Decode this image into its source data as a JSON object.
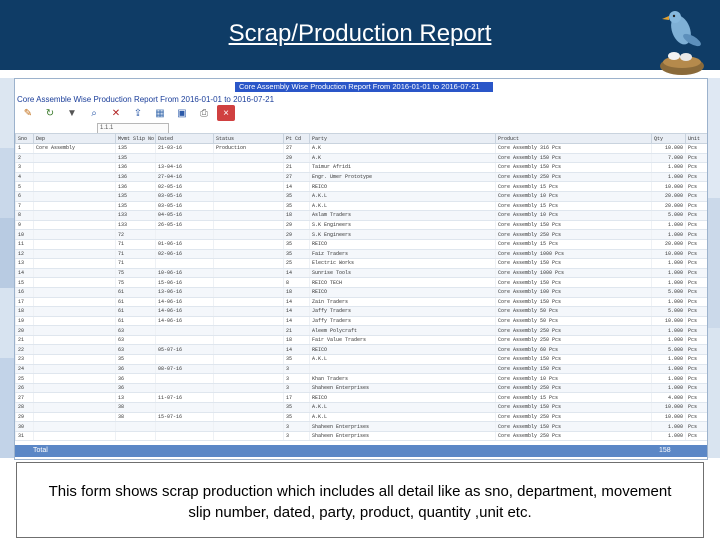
{
  "slide": {
    "title": "Scrap/Production Report",
    "caption": "This form shows scrap production which includes all detail like as sno, department, movement slip number, dated, party, product, quantity ,unit etc."
  },
  "app": {
    "report_banner": "Core Assembly Wise Production Report From 2016-01-01 to 2016-07-21",
    "window_caption": "Core Assemble Wise Production Report From 2016-01-01 to 2016-07-21",
    "toolbar_icons": [
      "pencil-icon",
      "refresh-icon",
      "filter-icon",
      "find-icon",
      "delete-icon",
      "export-icon",
      "grid-icon",
      "save-icon",
      "print-icon",
      "close-icon"
    ],
    "filter_placeholder": "1.1.1",
    "columns": [
      "Sno",
      "Dep",
      "Mvmt Slip No",
      "Dated",
      "Status",
      "Pt Cd",
      "Party",
      "Product",
      "Qty",
      "Unit"
    ],
    "rows": [
      [
        "1",
        "Core Assembly",
        "135",
        "21-03-16",
        "Production",
        "27",
        "A.K",
        "Core Assembly 316 Pcs",
        "10.000",
        "Pcs"
      ],
      [
        "2",
        "",
        "135",
        "",
        "",
        "29",
        "A.K",
        "Core Assembly 150 Pcs",
        "7.000",
        "Pcs"
      ],
      [
        "3",
        "",
        "136",
        "13-04-16",
        "",
        "21",
        "Taimur Afridi",
        "Core Assembly 150 Pcs",
        "1.000",
        "Pcs"
      ],
      [
        "4",
        "",
        "136",
        "27-04-16",
        "",
        "27",
        "Engr. Umer Prototype",
        "Core Assembly 250 Pcs",
        "1.000",
        "Pcs"
      ],
      [
        "5",
        "",
        "136",
        "02-05-16",
        "",
        "14",
        "REICO",
        "Core Assembly 15 Pcs",
        "10.000",
        "Pcs"
      ],
      [
        "6",
        "",
        "135",
        "03-05-16",
        "",
        "35",
        "A.K.L",
        "Core Assembly 10 Pcs",
        "20.000",
        "Pcs"
      ],
      [
        "7",
        "",
        "135",
        "03-05-16",
        "",
        "35",
        "A.K.L",
        "Core Assembly 15 Pcs",
        "20.000",
        "Pcs"
      ],
      [
        "8",
        "",
        "133",
        "04-05-16",
        "",
        "18",
        "Aslam Traders",
        "Core Assembly 10 Pcs",
        "5.000",
        "Pcs"
      ],
      [
        "9",
        "",
        "133",
        "26-05-16",
        "",
        "29",
        "S.K Engineers",
        "Core Assembly 150 Pcs",
        "1.000",
        "Pcs"
      ],
      [
        "10",
        "",
        "72",
        "",
        "",
        "29",
        "S.K Engineers",
        "Core Assembly 250 Pcs",
        "1.000",
        "Pcs"
      ],
      [
        "11",
        "",
        "71",
        "01-06-16",
        "",
        "35",
        "REICO",
        "Core Assembly 15 Pcs",
        "20.000",
        "Pcs"
      ],
      [
        "12",
        "",
        "71",
        "02-06-16",
        "",
        "35",
        "Faiz Traders",
        "Core Assembly 1000 Pcs",
        "10.000",
        "Pcs"
      ],
      [
        "13",
        "",
        "71",
        "",
        "",
        "25",
        "Electric Works",
        "Core Assembly 150 Pcs",
        "1.000",
        "Pcs"
      ],
      [
        "14",
        "",
        "75",
        "10-06-16",
        "",
        "14",
        "Sunrise Tools",
        "Core Assembly 1000 Pcs",
        "1.000",
        "Pcs"
      ],
      [
        "15",
        "",
        "75",
        "15-06-16",
        "",
        "8",
        "REICO TECH",
        "Core Assembly 150 Pcs",
        "1.000",
        "Pcs"
      ],
      [
        "16",
        "",
        "61",
        "13-06-16",
        "",
        "18",
        "REICO",
        "Core Assembly 100 Pcs",
        "5.000",
        "Pcs"
      ],
      [
        "17",
        "",
        "61",
        "14-06-16",
        "",
        "14",
        "Zain Traders",
        "Core Assembly 150 Pcs",
        "1.000",
        "Pcs"
      ],
      [
        "18",
        "",
        "61",
        "14-06-16",
        "",
        "14",
        "Jaffy Traders",
        "Core Assembly 50 Pcs",
        "5.000",
        "Pcs"
      ],
      [
        "19",
        "",
        "61",
        "14-06-16",
        "",
        "14",
        "Jaffy Traders",
        "Core Assembly 50 Pcs",
        "10.000",
        "Pcs"
      ],
      [
        "20",
        "",
        "63",
        "",
        "",
        "21",
        "Aleem Polycraft",
        "Core Assembly 250 Pcs",
        "1.000",
        "Pcs"
      ],
      [
        "21",
        "",
        "63",
        "",
        "",
        "18",
        "Fair Value Traders",
        "Core Assembly 250 Pcs",
        "1.000",
        "Pcs"
      ],
      [
        "22",
        "",
        "63",
        "05-07-16",
        "",
        "14",
        "REICO",
        "Core Assembly 60 Pcs",
        "5.000",
        "Pcs"
      ],
      [
        "23",
        "",
        "35",
        "",
        "",
        "35",
        "A.K.L",
        "Core Assembly 150 Pcs",
        "1.000",
        "Pcs"
      ],
      [
        "24",
        "",
        "36",
        "08-07-16",
        "",
        "3",
        "",
        "Core Assembly 150 Pcs",
        "1.000",
        "Pcs"
      ],
      [
        "25",
        "",
        "36",
        "",
        "",
        "3",
        "Khan Traders",
        "Core Assembly 10 Pcs",
        "1.000",
        "Pcs"
      ],
      [
        "26",
        "",
        "36",
        "",
        "",
        "3",
        "Shaheen Enterprises",
        "Core Assembly 250 Pcs",
        "1.000",
        "Pcs"
      ],
      [
        "27",
        "",
        "13",
        "11-07-16",
        "",
        "17",
        "REICO",
        "Core Assembly 15 Pcs",
        "4.000",
        "Pcs"
      ],
      [
        "28",
        "",
        "38",
        "",
        "",
        "35",
        "A.K.L",
        "Core Assembly 150 Pcs",
        "10.000",
        "Pcs"
      ],
      [
        "29",
        "",
        "38",
        "15-07-16",
        "",
        "35",
        "A.K.L",
        "Core Assembly 250 Pcs",
        "10.000",
        "Pcs"
      ],
      [
        "30",
        "",
        "",
        "",
        "",
        "3",
        "Shaheen Enterprises",
        "Core Assembly 150 Pcs",
        "1.000",
        "Pcs"
      ],
      [
        "31",
        "",
        "",
        "",
        "",
        "3",
        "Shaheen Enterprises",
        "Core Assembly 250 Pcs",
        "1.000",
        "Pcs"
      ]
    ],
    "total_label": "Total",
    "total_value": "158"
  },
  "colors": {
    "header_blue": "#0f3c66",
    "banner_blue": "#2a56c8",
    "total_bar": "#5b87c6"
  }
}
